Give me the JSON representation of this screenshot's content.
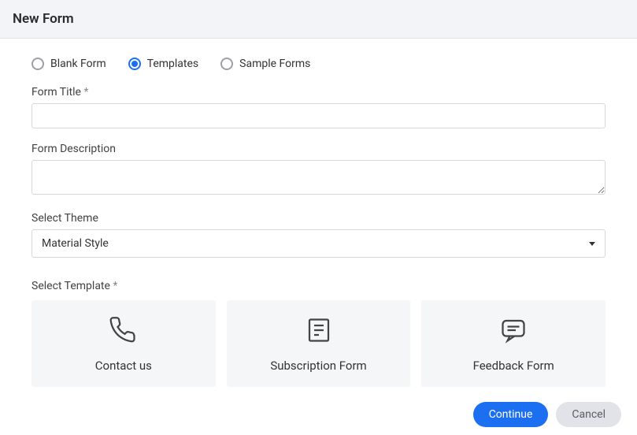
{
  "header": {
    "title": "New Form"
  },
  "radios": {
    "blank": {
      "label": "Blank Form",
      "selected": false
    },
    "templates": {
      "label": "Templates",
      "selected": true
    },
    "sample": {
      "label": "Sample Forms",
      "selected": false
    }
  },
  "fields": {
    "title": {
      "label": "Form Title ",
      "required": "*",
      "value": ""
    },
    "description": {
      "label": "Form Description",
      "value": ""
    },
    "theme": {
      "label": "Select Theme",
      "value": "Material Style"
    },
    "template": {
      "label": "Select Template ",
      "required": "*"
    }
  },
  "templates": [
    {
      "icon": "phone-icon",
      "label": "Contact us"
    },
    {
      "icon": "document-icon",
      "label": "Subscription Form"
    },
    {
      "icon": "chat-icon",
      "label": "Feedback Form"
    }
  ],
  "footer": {
    "continue": "Continue",
    "cancel": "Cancel"
  }
}
